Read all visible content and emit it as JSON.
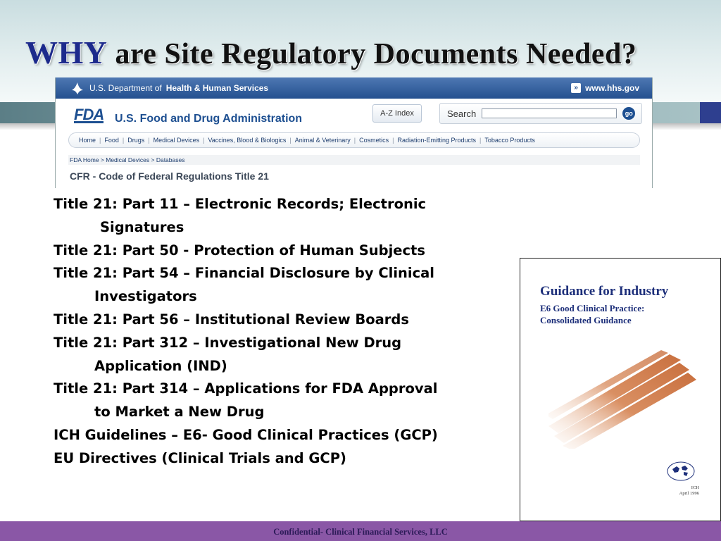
{
  "slide": {
    "title_emphasis": "WHY",
    "title_rest": "are Site Regulatory Documents Needed?"
  },
  "fda_page": {
    "hhs_prefix": "U.S. Department of",
    "hhs_name": "Health & Human Services",
    "hhs_link": "www.hhs.gov",
    "logo": "FDA",
    "agency_name": "U.S. Food and Drug Administration",
    "az_index": "A-Z Index",
    "search_label": "Search",
    "search_value": "",
    "go_label": "go",
    "nav": [
      "Home",
      "Food",
      "Drugs",
      "Medical Devices",
      "Vaccines, Blood & Biologics",
      "Animal & Veterinary",
      "Cosmetics",
      "Radiation-Emitting Products",
      "Tobacco Products"
    ],
    "breadcrumb": "FDA Home > Medical Devices > Databases",
    "page_heading": "CFR - Code of Federal Regulations Title 21"
  },
  "regulations": [
    {
      "text": "Title 21:  Part 11 – Electronic Records; Electronic",
      "indent": 0
    },
    {
      "text": "Signatures",
      "indent": 1
    },
    {
      "text": "Title 21:  Part 50 -  Protection of Human Subjects",
      "indent": 0
    },
    {
      "text": "Title 21:  Part 54 – Financial Disclosure by Clinical",
      "indent": 0
    },
    {
      "text": "Investigators",
      "indent": 2
    },
    {
      "text": "Title 21:  Part 56 – Institutional Review Boards",
      "indent": 0
    },
    {
      "text": "Title 21:  Part 312 – Investigational New Drug",
      "indent": 0
    },
    {
      "text": "Application (IND)",
      "indent": 2
    },
    {
      "text": "Title 21: Part 314 – Applications for FDA Approval",
      "indent": 0
    },
    {
      "text": "to Market a New Drug",
      "indent": 2
    },
    {
      "text": "ICH Guidelines – E6- Good Clinical Practices (GCP)",
      "indent": 0
    },
    {
      "text": "EU Directives (Clinical Trials and GCP)",
      "indent": 0
    }
  ],
  "guidance_doc": {
    "title": "Guidance for Industry",
    "subtitle_line1": "E6 Good Clinical Practice:",
    "subtitle_line2": "Consolidated Guidance",
    "ich_label": "ICH",
    "date": "April 1996"
  },
  "footer": "Confidential- Clinical Financial Services, LLC",
  "colors": {
    "title_accent": "#1c2a8c",
    "hhs_bar": "#24508f",
    "fda_blue": "#1d4f91",
    "footer_bg": "#8a57a6",
    "footer_text": "#2b1a57"
  }
}
